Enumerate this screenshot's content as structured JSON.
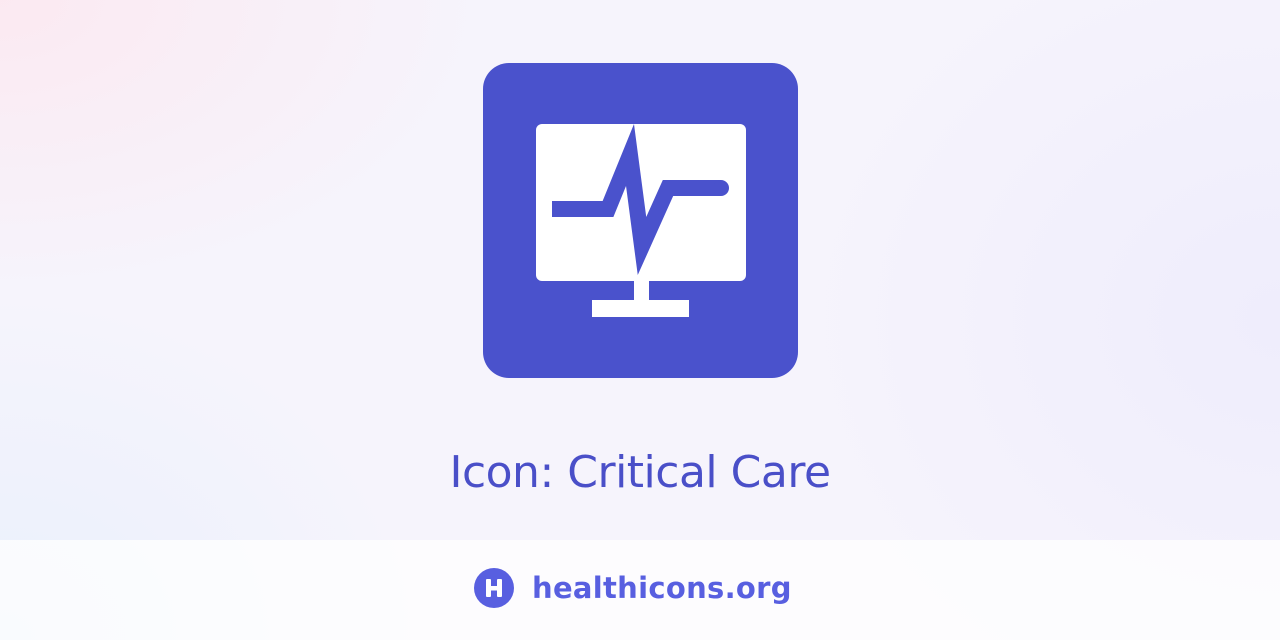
{
  "icon": {
    "name": "critical-care-icon",
    "background_color": "#4a52cc",
    "foreground_color": "#ffffff"
  },
  "title": "Icon: Critical Care",
  "footer": {
    "logo_icon": "healthicons-logo-icon",
    "site_name": "healthicons.org",
    "brand_color": "#585fe0"
  }
}
